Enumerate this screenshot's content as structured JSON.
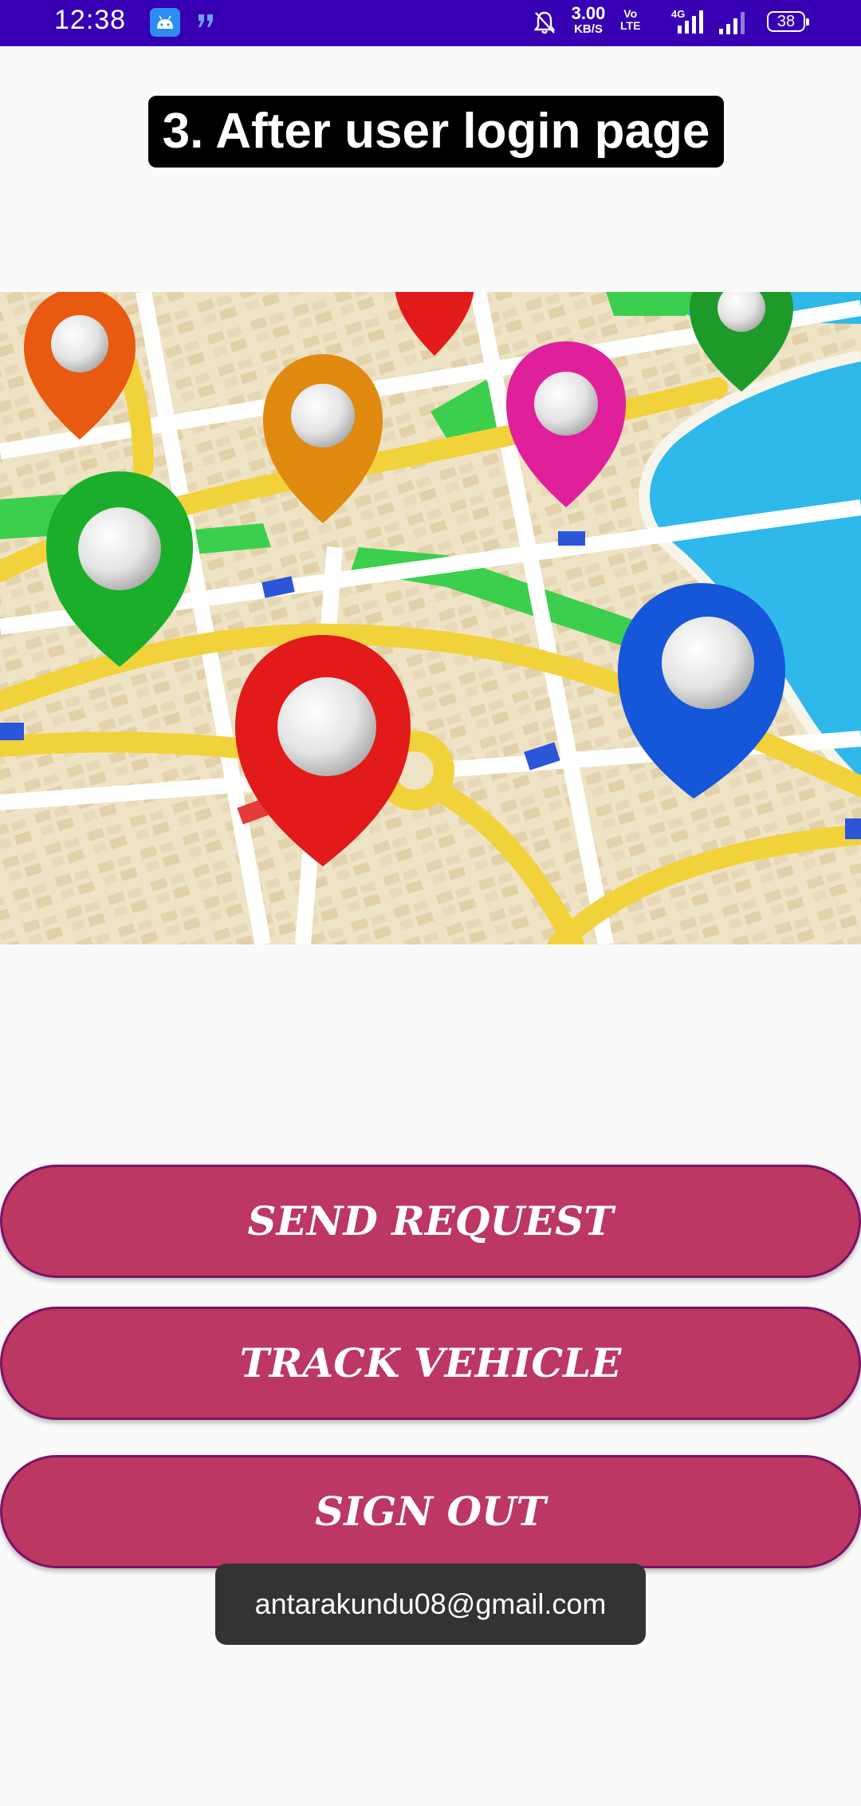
{
  "status_bar": {
    "time": "12:38",
    "net_speed_value": "3.00",
    "net_speed_unit": "KB/S",
    "volte_line1": "Vo",
    "volte_line2": "LTE",
    "network_type": "4G",
    "battery": "38",
    "icons": [
      "android-icon",
      "quote-icon",
      "bell-off-icon",
      "signal-4g-icon",
      "signal-icon",
      "battery-icon"
    ]
  },
  "header": {
    "title": "3. After user login page"
  },
  "hero_image": {
    "icon": "map-pins-illustration",
    "pin_colors": [
      "#e85a0f",
      "#e21a1a",
      "#1e9a2a",
      "#e08a10",
      "#e0209a",
      "#1bae2a",
      "#e21a1a",
      "#1557d8"
    ]
  },
  "actions": {
    "send_request": "SEND REQUEST",
    "track_vehicle": "TRACK VEHICLE",
    "sign_out": "SIGN OUT"
  },
  "toast": {
    "message": "antarakundu08@gmail.com"
  },
  "colors": {
    "status_bar": "#3700b3",
    "button_fill": "#bc3761",
    "button_border": "#7a1269",
    "toast_bg": "#333333",
    "background": "#fafafa"
  }
}
